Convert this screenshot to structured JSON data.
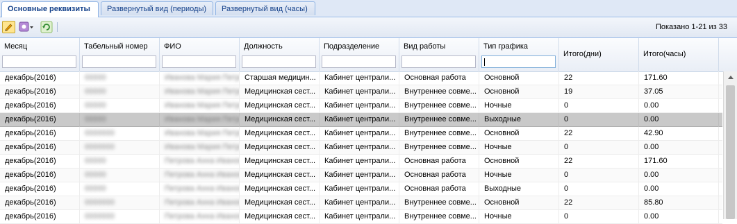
{
  "tabs": [
    {
      "label": "Основные реквизиты",
      "active": true
    },
    {
      "label": "Развернутый вид (периоды)",
      "active": false
    },
    {
      "label": "Развернутый вид (часы)",
      "active": false
    }
  ],
  "toolbar": {
    "paging_text": "Показано 1-21 из 33",
    "edit_icon": "pencil-icon",
    "settings_icon": "gear-dropdown-icon",
    "refresh_icon": "refresh-icon"
  },
  "columns": [
    {
      "label": "Месяц",
      "filter": true
    },
    {
      "label": "Табельный номер",
      "filter": true
    },
    {
      "label": "ФИО",
      "filter": true
    },
    {
      "label": "Должность",
      "filter": true
    },
    {
      "label": "Подразделение",
      "filter": true
    },
    {
      "label": "Вид работы",
      "filter": true
    },
    {
      "label": "Тип графика",
      "filter": true
    },
    {
      "label": "Итого(дни)",
      "filter": false
    },
    {
      "label": "Итого(часы)",
      "filter": false
    }
  ],
  "rows": [
    {
      "month": "декабрь(2016)",
      "tab": "00000",
      "fio": "Иванова Мария Петровна",
      "position": "Старшая медицин...",
      "dept": "Кабинет централи...",
      "work": "Основная работа",
      "schedule": "Основной",
      "days": "22",
      "hours": "171.60",
      "selected": false
    },
    {
      "month": "декабрь(2016)",
      "tab": "00000",
      "fio": "Иванова Мария Петровна",
      "position": "Медицинская сест...",
      "dept": "Кабинет централи...",
      "work": "Внутреннее совме...",
      "schedule": "Основной",
      "days": "19",
      "hours": "37.05",
      "selected": false
    },
    {
      "month": "декабрь(2016)",
      "tab": "00000",
      "fio": "Иванова Мария Петровна",
      "position": "Медицинская сест...",
      "dept": "Кабинет централи...",
      "work": "Внутреннее совме...",
      "schedule": "Ночные",
      "days": "0",
      "hours": "0.00",
      "selected": false
    },
    {
      "month": "декабрь(2016)",
      "tab": "00000",
      "fio": "Иванова Мария Петровна",
      "position": "Медицинская сест...",
      "dept": "Кабинет централи...",
      "work": "Внутреннее совме...",
      "schedule": "Выходные",
      "days": "0",
      "hours": "0.00",
      "selected": true
    },
    {
      "month": "декабрь(2016)",
      "tab": "0000000",
      "fio": "Иванова Мария Петровна",
      "position": "Медицинская сест...",
      "dept": "Кабинет централи...",
      "work": "Внутреннее совме...",
      "schedule": "Основной",
      "days": "22",
      "hours": "42.90",
      "selected": false
    },
    {
      "month": "декабрь(2016)",
      "tab": "0000000",
      "fio": "Иванова Мария Петровна",
      "position": "Медицинская сест...",
      "dept": "Кабинет централи...",
      "work": "Внутреннее совме...",
      "schedule": "Ночные",
      "days": "0",
      "hours": "0.00",
      "selected": false
    },
    {
      "month": "декабрь(2016)",
      "tab": "00000",
      "fio": "Петрова Анна Ивановна",
      "position": "Медицинская сест...",
      "dept": "Кабинет централи...",
      "work": "Основная работа",
      "schedule": "Основной",
      "days": "22",
      "hours": "171.60",
      "selected": false
    },
    {
      "month": "декабрь(2016)",
      "tab": "00000",
      "fio": "Петрова Анна Ивановна",
      "position": "Медицинская сест...",
      "dept": "Кабинет централи...",
      "work": "Основная работа",
      "schedule": "Ночные",
      "days": "0",
      "hours": "0.00",
      "selected": false
    },
    {
      "month": "декабрь(2016)",
      "tab": "00000",
      "fio": "Петрова Анна Ивановна",
      "position": "Медицинская сест...",
      "dept": "Кабинет централи...",
      "work": "Основная работа",
      "schedule": "Выходные",
      "days": "0",
      "hours": "0.00",
      "selected": false
    },
    {
      "month": "декабрь(2016)",
      "tab": "0000000",
      "fio": "Петрова Анна Ивановна",
      "position": "Медицинская сест...",
      "dept": "Кабинет централи...",
      "work": "Внутреннее совме...",
      "schedule": "Основной",
      "days": "22",
      "hours": "85.80",
      "selected": false
    },
    {
      "month": "декабрь(2016)",
      "tab": "0000000",
      "fio": "Петрова Анна Ивановна",
      "position": "Медицинская сест...",
      "dept": "Кабинет централи...",
      "work": "Внутреннее совме...",
      "schedule": "Ночные",
      "days": "0",
      "hours": "0.00",
      "selected": false
    }
  ],
  "colors": {
    "accent": "#15428b",
    "header_bg": "#dfe8f6",
    "selected_row": "#c9c9c9"
  }
}
